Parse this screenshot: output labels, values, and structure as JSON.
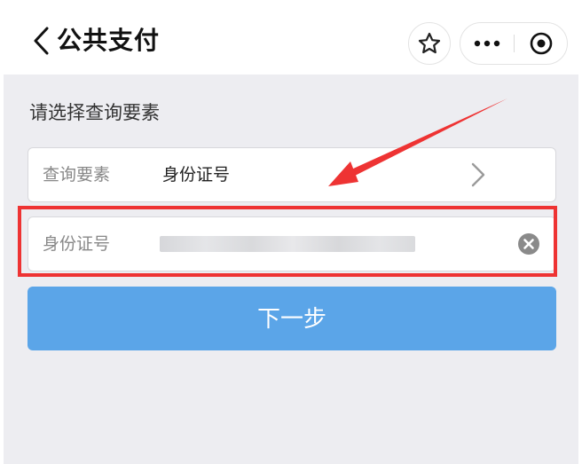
{
  "header": {
    "title": "公共支付",
    "back_icon": "chevron-left-icon",
    "star_icon": "star-icon",
    "more_icon": "more-dots-icon",
    "target_icon": "target-icon"
  },
  "form": {
    "section_label": "请选择查询要素",
    "query_field": {
      "label": "查询要素",
      "value": "身份证号",
      "icon": "chevron-right-icon"
    },
    "id_field": {
      "label": "身份证号",
      "value_obscured": true,
      "clear_icon": "clear-icon"
    },
    "next_button": "下一步"
  },
  "annotations": {
    "highlight_color": "#ee3333",
    "arrow_color": "#ee3333"
  },
  "colors": {
    "primary_button": "#5ba5e8",
    "background": "#ededf1"
  }
}
